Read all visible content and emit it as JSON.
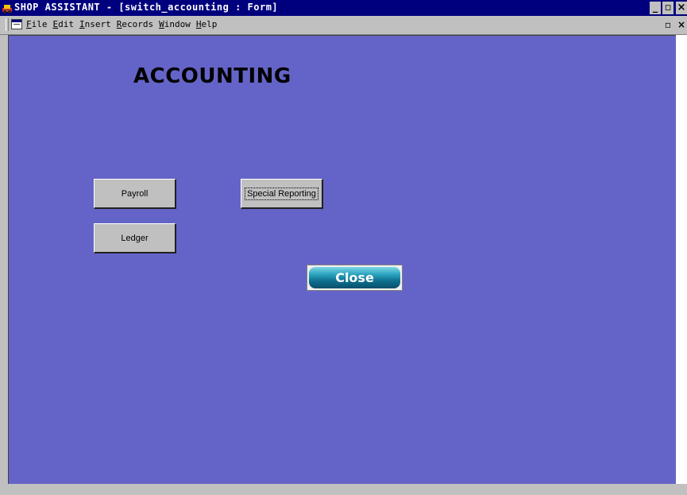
{
  "window": {
    "title": "SHOP ASSISTANT - [switch_accounting : Form]",
    "minimize_label": "_",
    "restore_label": "▫",
    "close_label": "×"
  },
  "menubar": {
    "items": [
      {
        "accel": "F",
        "rest": "ile"
      },
      {
        "accel": "E",
        "rest": "dit"
      },
      {
        "accel": "I",
        "rest": "nsert"
      },
      {
        "accel": "R",
        "rest": "ecords"
      },
      {
        "accel": "W",
        "rest": "indow"
      },
      {
        "accel": "H",
        "rest": "elp"
      }
    ],
    "doc_restore_label": "▫",
    "doc_close_label": "×"
  },
  "form": {
    "title": "ACCOUNTING",
    "payroll_label": "Payroll",
    "ledger_label": "Ledger",
    "special_reporting_label": "Special Reporting",
    "close_label": "Close",
    "background_color": "#6464c8"
  }
}
